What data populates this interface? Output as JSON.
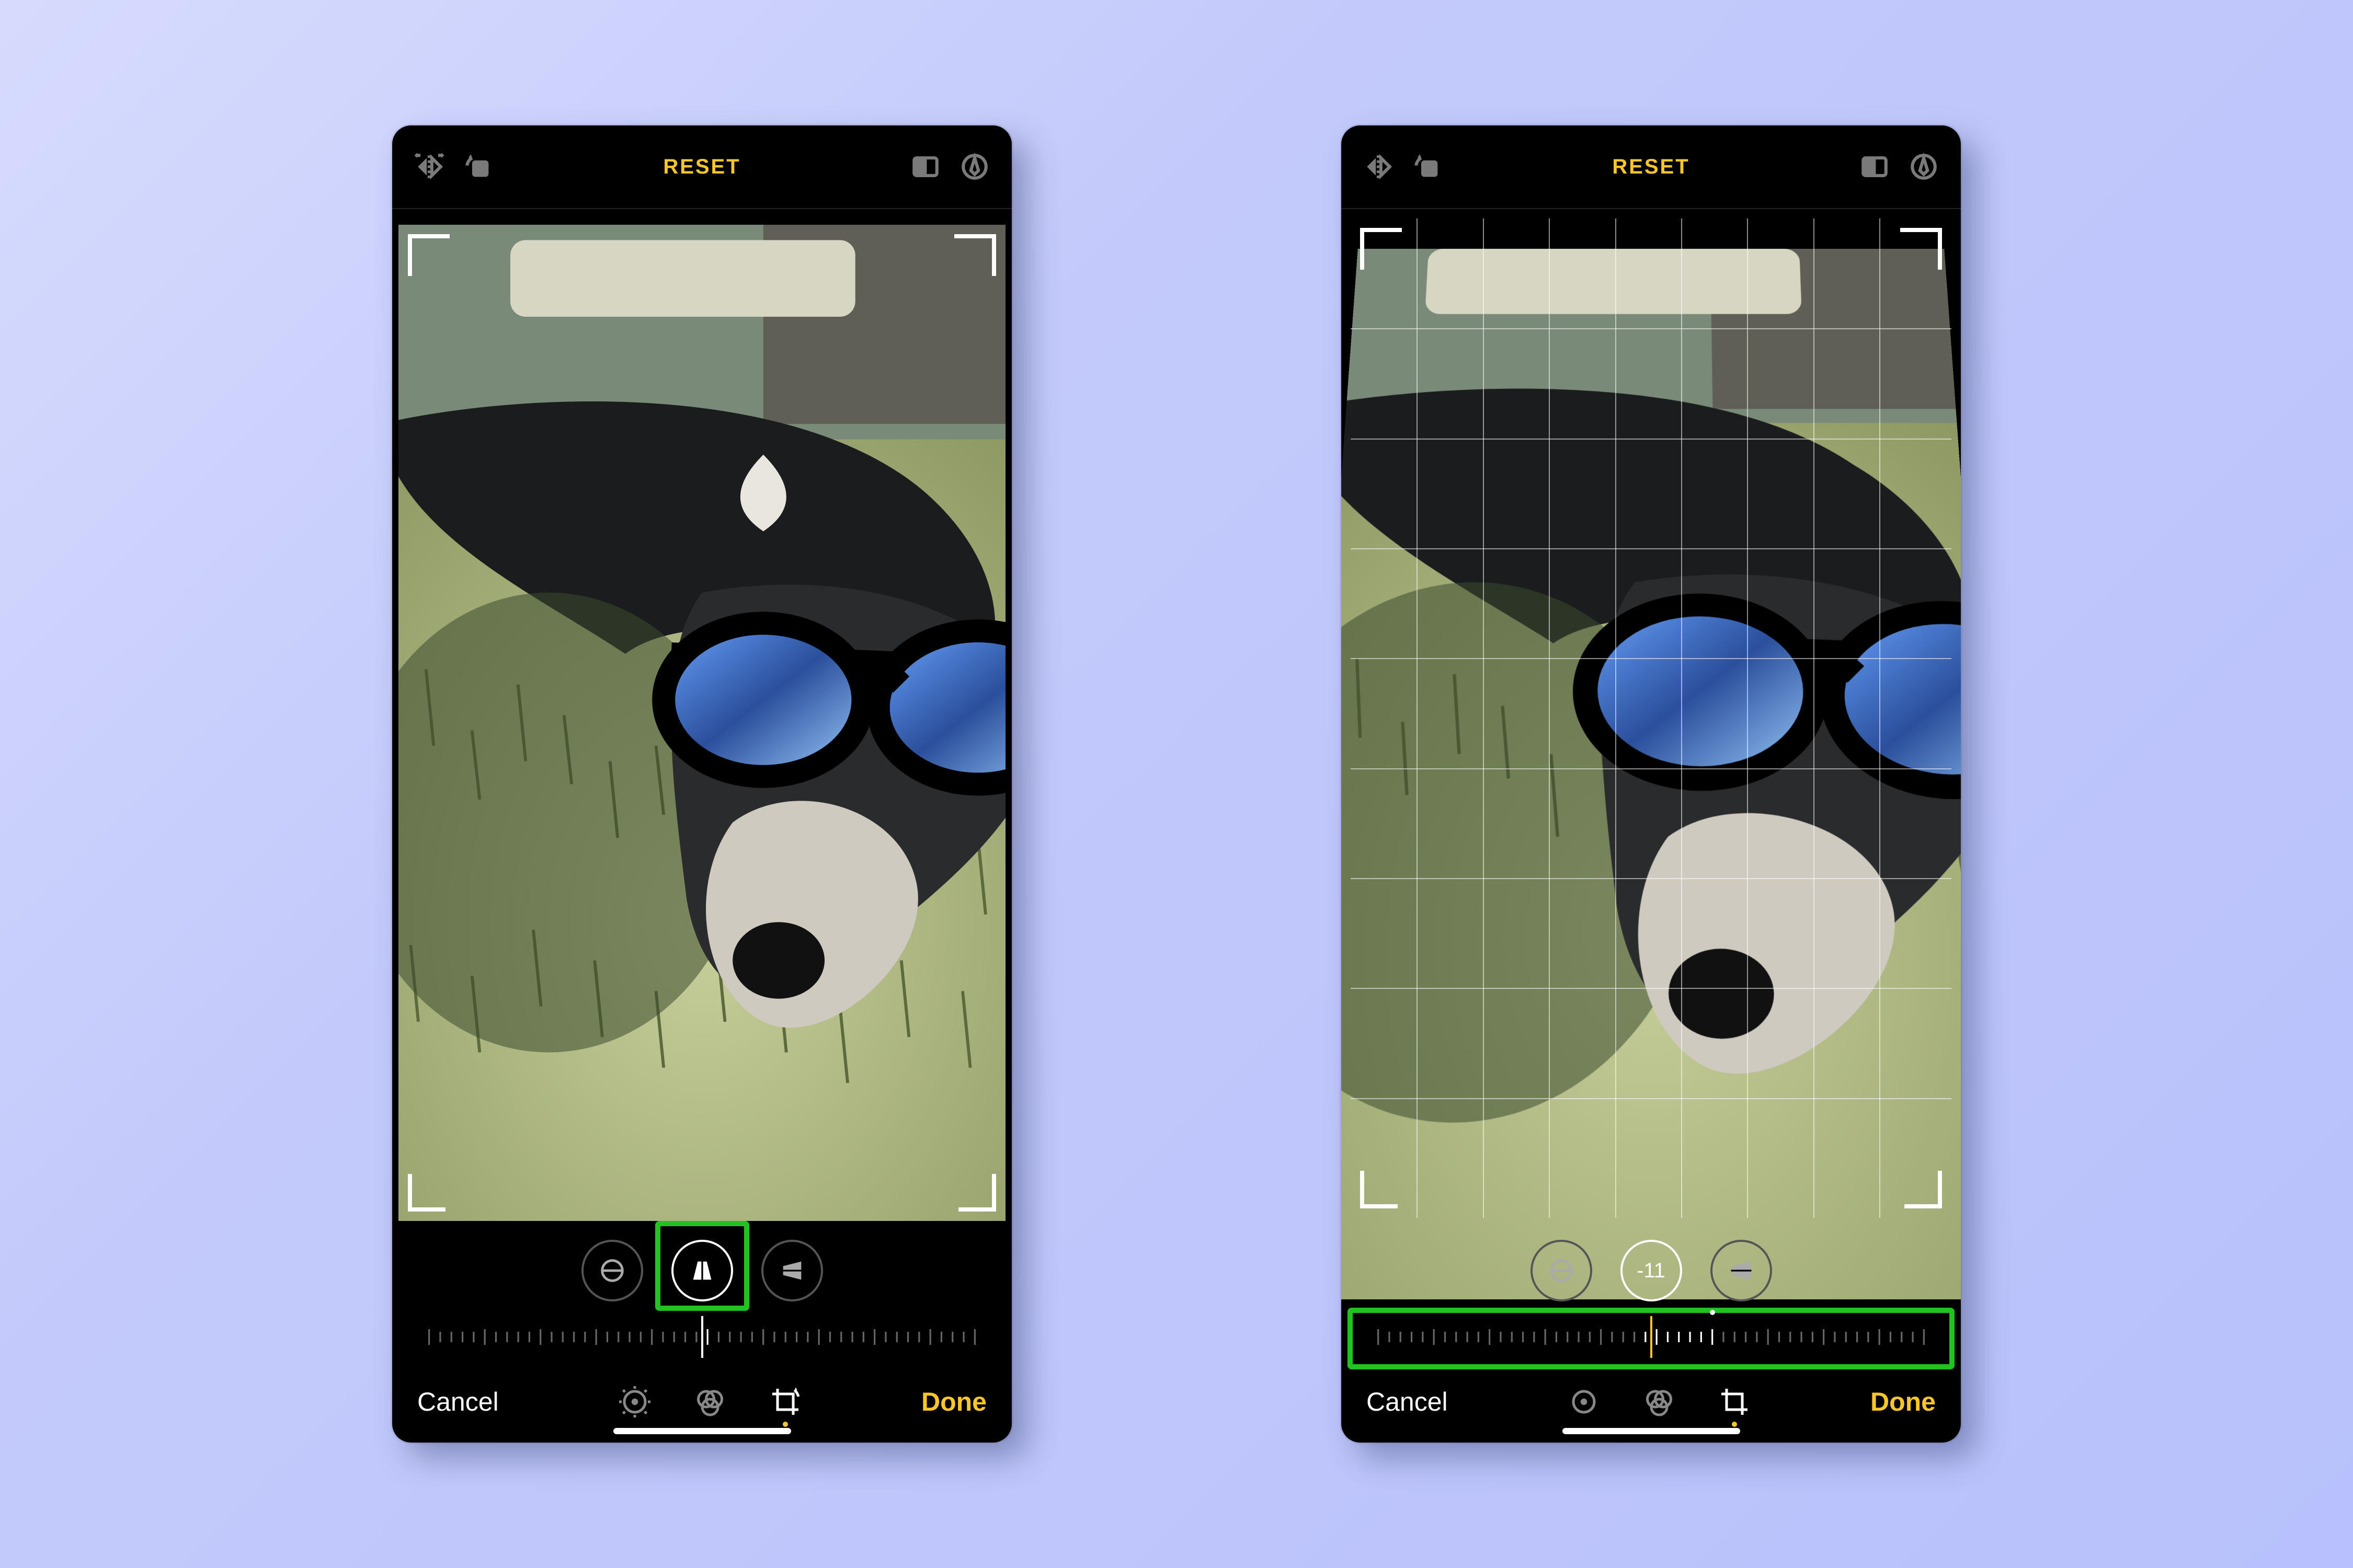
{
  "left": {
    "toolbar": {
      "reset_label": "RESET"
    },
    "perspective": {
      "selected_index": 1,
      "value_label": "",
      "dial_offset_pct": 50
    },
    "bottom": {
      "cancel_label": "Cancel",
      "done_label": "Done",
      "active_mode": "crop"
    },
    "highlight": "tool"
  },
  "right": {
    "toolbar": {
      "reset_label": "RESET"
    },
    "perspective": {
      "selected_index": 1,
      "value_label": "-11",
      "dial_offset_pct": 50,
      "origin_dot_pct": 61
    },
    "bottom": {
      "cancel_label": "Cancel",
      "done_label": "Done",
      "active_mode": "crop"
    },
    "highlight": "dial"
  },
  "icons": {
    "flip": "flip-horizontal-icon",
    "rotate": "rotate-ccw-icon",
    "aspect": "aspect-ratio-icon",
    "markup": "markup-pen-icon",
    "straighten": "straighten-tool-icon",
    "persp_v": "vertical-perspective-tool-icon",
    "persp_h": "horizontal-perspective-tool-icon",
    "mode_adjust": "adjust-dial-icon",
    "mode_filters": "filters-icon",
    "mode_crop": "crop-rotate-icon"
  }
}
